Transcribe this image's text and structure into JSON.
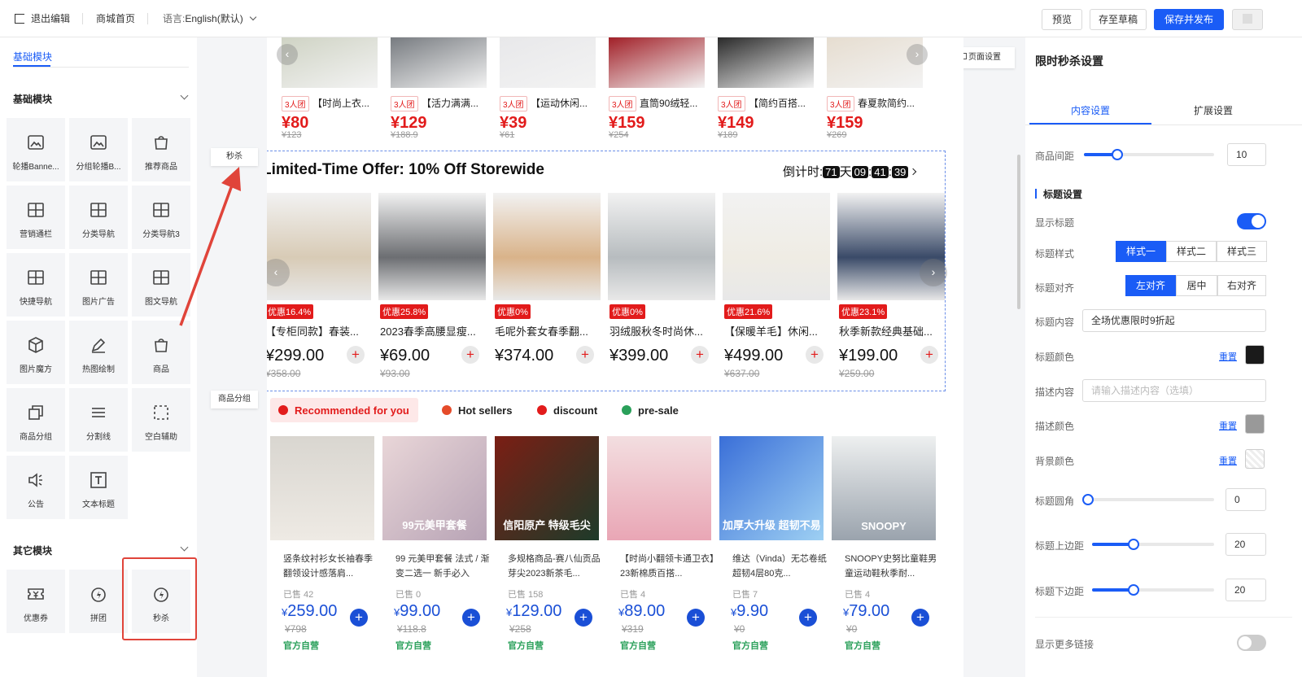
{
  "topbar": {
    "exit": "退出编辑",
    "home": "商城首页",
    "language_label": "语言:",
    "language_value": "English(默认)",
    "preview": "预览",
    "save_draft": "存至草稿",
    "save_publish": "保存并发布"
  },
  "left": {
    "tab": "基础模块",
    "basic_section": "基础模块",
    "other_section": "其它模块",
    "basic_items": [
      "轮播Banne...",
      "分组轮播B...",
      "推荐商品",
      "营销通栏",
      "分类导航",
      "分类导航3",
      "快捷导航",
      "图片广告",
      "图文导航",
      "图片魔方",
      "热图绘制",
      "商品",
      "商品分组",
      "分割线",
      "空白辅助",
      "公告",
      "文本标题"
    ],
    "other_items": [
      "优惠券",
      "拼团",
      "秒杀"
    ]
  },
  "floats": {
    "seckill": "秒杀",
    "goods_group": "商品分组",
    "page_settings": "页面设置"
  },
  "group_row": [
    {
      "badge": "3人团",
      "title": "【时尚上衣...",
      "price": "¥80",
      "old": "¥123"
    },
    {
      "badge": "3人团",
      "title": "【活力满满...",
      "price": "¥129",
      "old": "¥188.9"
    },
    {
      "badge": "3人团",
      "title": "【运动休闲...",
      "price": "¥39",
      "old": "¥61"
    },
    {
      "badge": "3人团",
      "title": "直筒90绒轻...",
      "price": "¥159",
      "old": "¥254"
    },
    {
      "badge": "3人团",
      "title": "【简约百搭...",
      "price": "¥149",
      "old": "¥189"
    },
    {
      "badge": "3人团",
      "title": "春夏款简约...",
      "price": "¥159",
      "old": "¥269"
    }
  ],
  "flash": {
    "title": "Limited-Time Offer: 10% Off Storewide",
    "countdown_label": "倒计时:",
    "days": "71",
    "day_unit": "天",
    "hours": "09",
    "minutes": "41",
    "seconds": "39",
    "sep": ":",
    "items": [
      {
        "badge": "优惠16.4%",
        "title": "【专柜同款】春装...",
        "price": "¥299.00",
        "old": "¥358.00"
      },
      {
        "badge": "优惠25.8%",
        "title": "2023春季高腰显瘦...",
        "price": "¥69.00",
        "old": "¥93.00"
      },
      {
        "badge": "优惠0%",
        "title": "毛呢外套女春季翻...",
        "price": "¥374.00",
        "old": ""
      },
      {
        "badge": "优惠0%",
        "title": "羽绒服秋冬时尚休...",
        "price": "¥399.00",
        "old": ""
      },
      {
        "badge": "优惠21.6%",
        "title": "【保暖羊毛】休闲...",
        "price": "¥499.00",
        "old": "¥637.00"
      },
      {
        "badge": "优惠23.1%",
        "title": "秋季新款经典基础...",
        "price": "¥199.00",
        "old": "¥259.00"
      }
    ]
  },
  "tabs": [
    "Recommended for you",
    "Hot sellers",
    "discount",
    "pre-sale"
  ],
  "goods": [
    {
      "title": "竖条纹衬衫女长袖春季翻领设计感落肩...",
      "sold": "已售 42",
      "price_int": "259.00",
      "old": "¥798",
      "own": "官方自营",
      "img_text": ""
    },
    {
      "title": "99 元美甲套餐 法式 / 渐变二选一 新手必入",
      "sold": "已售 0",
      "price_int": "99.00",
      "old": "¥118.8",
      "own": "官方自营",
      "img_text": "99元美甲套餐"
    },
    {
      "title": "多规格商品-赛八仙贡品芽尖2023新茶毛...",
      "sold": "已售 158",
      "price_int": "129.00",
      "old": "¥258",
      "own": "官方自营",
      "img_text": "信阳原产 特级毛尖"
    },
    {
      "title": "【时尚小翻领卡通卫衣】23新棉质百搭...",
      "sold": "已售 4",
      "price_int": "89.00",
      "old": "¥319",
      "own": "官方自营",
      "img_text": ""
    },
    {
      "title": "维达（Vinda）无芯卷纸 超韧4层80克...",
      "sold": "已售 7",
      "price_int": "9.90",
      "old": "¥0",
      "own": "官方自营",
      "img_text": "加厚大升级 超韧不易破"
    },
    {
      "title": "SNOOPY史努比童鞋男童运动鞋秋季耐...",
      "sold": "已售 4",
      "price_int": "79.00",
      "old": "¥0",
      "own": "官方自营",
      "img_text": "SNOOPY"
    }
  ],
  "right": {
    "title": "限时秒杀设置",
    "tab_content": "内容设置",
    "tab_extend": "扩展设置",
    "goods_gap_label": "商品间距",
    "goods_gap_value": "10",
    "goods_gap_level": 0.25,
    "section_title": "标题设置",
    "show_title": "显示标题",
    "title_style": "标题样式",
    "title_style_opts": [
      "样式一",
      "样式二",
      "样式三"
    ],
    "title_align": "标题对齐",
    "title_align_opts": [
      "左对齐",
      "居中",
      "右对齐"
    ],
    "title_content_label": "标题内容",
    "title_content_value": "全场优惠限时9折起",
    "title_color": "标题颜色",
    "desc_content": "描述内容",
    "desc_placeholder": "请输入描述内容（选填）",
    "desc_color": "描述颜色",
    "bg_color": "背景颜色",
    "reset": "重置",
    "title_radius": "标题圆角",
    "title_radius_value": "0",
    "title_top": "标题上边距",
    "title_top_value": "20",
    "title_bottom": "标题下边距",
    "title_bottom_value": "20",
    "show_more": "显示更多链接",
    "colors": {
      "title": "#1a1a1a",
      "desc": "#999999",
      "accent": "#1a5cf6"
    }
  }
}
